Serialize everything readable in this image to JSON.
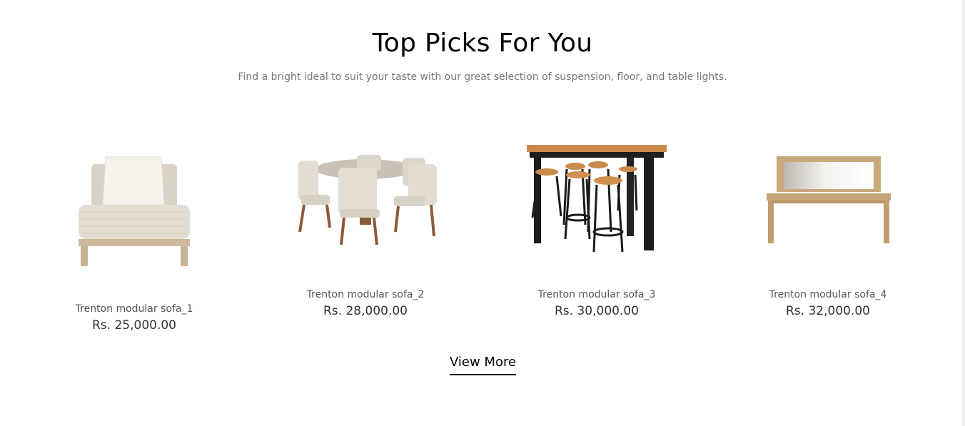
{
  "section": {
    "title": "Top Picks For You",
    "subtitle": "Find a bright ideal to suit your taste with our great selection of suspension, floor, and table lights."
  },
  "products": [
    {
      "name": "Trenton modular sofa_1",
      "price": "Rs. 25,000.00",
      "image": "armless-sofa-chair"
    },
    {
      "name": "Trenton modular sofa_2",
      "price": "Rs. 28,000.00",
      "image": "round-dining-table-set"
    },
    {
      "name": "Trenton modular sofa_3",
      "price": "Rs. 30,000.00",
      "image": "bar-table-with-stools"
    },
    {
      "name": "Trenton modular sofa_4",
      "price": "Rs. 32,000.00",
      "image": "console-table-with-mirror"
    }
  ],
  "view_more_label": "View More"
}
